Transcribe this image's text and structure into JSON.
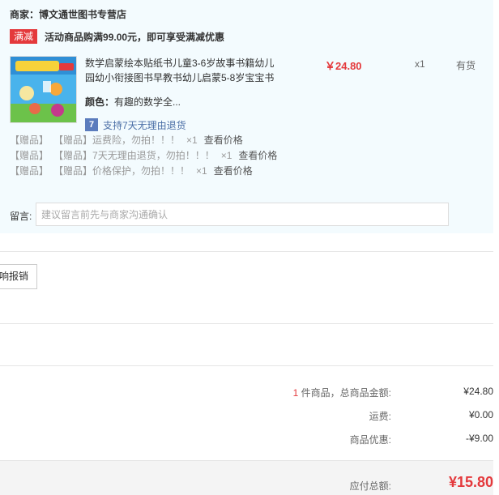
{
  "shop": {
    "label": "商家：",
    "name": "博文通世图书专营店"
  },
  "promo": {
    "badge": "满减",
    "text": "活动商品购满99.00元，即可享受满减优惠"
  },
  "item": {
    "title": "数学启蒙绘本贴纸书儿童3-6岁故事书籍幼儿园幼小衔接图书早教书幼儿启蒙5-8岁宝宝书",
    "price": "￥24.80",
    "qty": "x1",
    "stock": "有货",
    "color_label": "颜色：",
    "color_value": "有趣的数学全...",
    "return_icon": "7",
    "return_text": "支持7天无理由退货"
  },
  "gifts": [
    {
      "tag1": "【赠品】",
      "tag2": "【赠品】",
      "text": "运费险，勿拍！！！",
      "qty": "×1",
      "check": "查看价格"
    },
    {
      "tag1": "【赠品】",
      "tag2": "【赠品】",
      "text": "7天无理由退货，勿拍！！！",
      "qty": "×1",
      "check": "查看价格"
    },
    {
      "tag1": "【赠品】",
      "tag2": "【赠品】",
      "text": "价格保护，勿拍！！！",
      "qty": "×1",
      "check": "查看价格"
    }
  ],
  "message": {
    "label": "留言:",
    "placeholder": "建议留言前先与商家沟通确认"
  },
  "invoice": {
    "label": "响报销"
  },
  "summary": {
    "count": "1",
    "count_suffix": " 件商品，总商品金额:",
    "goods_total": "¥24.80",
    "shipping_label": "运费:",
    "shipping": "¥0.00",
    "discount_label": "商品优惠:",
    "discount": "-¥9.00",
    "payable_label": "应付总额:",
    "payable": "¥15.80"
  },
  "colors": {
    "accent": "#e4393c",
    "panel": "#f3fbfe",
    "link": "#4a6ea6"
  }
}
